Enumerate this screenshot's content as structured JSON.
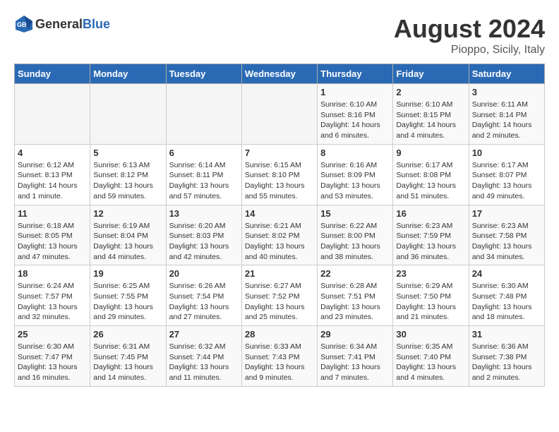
{
  "header": {
    "logo_general": "General",
    "logo_blue": "Blue",
    "month_year": "August 2024",
    "location": "Pioppo, Sicily, Italy"
  },
  "weekdays": [
    "Sunday",
    "Monday",
    "Tuesday",
    "Wednesday",
    "Thursday",
    "Friday",
    "Saturday"
  ],
  "weeks": [
    [
      {
        "day": "",
        "info": ""
      },
      {
        "day": "",
        "info": ""
      },
      {
        "day": "",
        "info": ""
      },
      {
        "day": "",
        "info": ""
      },
      {
        "day": "1",
        "info": "Sunrise: 6:10 AM\nSunset: 8:16 PM\nDaylight: 14 hours and 6 minutes."
      },
      {
        "day": "2",
        "info": "Sunrise: 6:10 AM\nSunset: 8:15 PM\nDaylight: 14 hours and 4 minutes."
      },
      {
        "day": "3",
        "info": "Sunrise: 6:11 AM\nSunset: 8:14 PM\nDaylight: 14 hours and 2 minutes."
      }
    ],
    [
      {
        "day": "4",
        "info": "Sunrise: 6:12 AM\nSunset: 8:13 PM\nDaylight: 14 hours and 1 minute."
      },
      {
        "day": "5",
        "info": "Sunrise: 6:13 AM\nSunset: 8:12 PM\nDaylight: 13 hours and 59 minutes."
      },
      {
        "day": "6",
        "info": "Sunrise: 6:14 AM\nSunset: 8:11 PM\nDaylight: 13 hours and 57 minutes."
      },
      {
        "day": "7",
        "info": "Sunrise: 6:15 AM\nSunset: 8:10 PM\nDaylight: 13 hours and 55 minutes."
      },
      {
        "day": "8",
        "info": "Sunrise: 6:16 AM\nSunset: 8:09 PM\nDaylight: 13 hours and 53 minutes."
      },
      {
        "day": "9",
        "info": "Sunrise: 6:17 AM\nSunset: 8:08 PM\nDaylight: 13 hours and 51 minutes."
      },
      {
        "day": "10",
        "info": "Sunrise: 6:17 AM\nSunset: 8:07 PM\nDaylight: 13 hours and 49 minutes."
      }
    ],
    [
      {
        "day": "11",
        "info": "Sunrise: 6:18 AM\nSunset: 8:05 PM\nDaylight: 13 hours and 47 minutes."
      },
      {
        "day": "12",
        "info": "Sunrise: 6:19 AM\nSunset: 8:04 PM\nDaylight: 13 hours and 44 minutes."
      },
      {
        "day": "13",
        "info": "Sunrise: 6:20 AM\nSunset: 8:03 PM\nDaylight: 13 hours and 42 minutes."
      },
      {
        "day": "14",
        "info": "Sunrise: 6:21 AM\nSunset: 8:02 PM\nDaylight: 13 hours and 40 minutes."
      },
      {
        "day": "15",
        "info": "Sunrise: 6:22 AM\nSunset: 8:00 PM\nDaylight: 13 hours and 38 minutes."
      },
      {
        "day": "16",
        "info": "Sunrise: 6:23 AM\nSunset: 7:59 PM\nDaylight: 13 hours and 36 minutes."
      },
      {
        "day": "17",
        "info": "Sunrise: 6:23 AM\nSunset: 7:58 PM\nDaylight: 13 hours and 34 minutes."
      }
    ],
    [
      {
        "day": "18",
        "info": "Sunrise: 6:24 AM\nSunset: 7:57 PM\nDaylight: 13 hours and 32 minutes."
      },
      {
        "day": "19",
        "info": "Sunrise: 6:25 AM\nSunset: 7:55 PM\nDaylight: 13 hours and 29 minutes."
      },
      {
        "day": "20",
        "info": "Sunrise: 6:26 AM\nSunset: 7:54 PM\nDaylight: 13 hours and 27 minutes."
      },
      {
        "day": "21",
        "info": "Sunrise: 6:27 AM\nSunset: 7:52 PM\nDaylight: 13 hours and 25 minutes."
      },
      {
        "day": "22",
        "info": "Sunrise: 6:28 AM\nSunset: 7:51 PM\nDaylight: 13 hours and 23 minutes."
      },
      {
        "day": "23",
        "info": "Sunrise: 6:29 AM\nSunset: 7:50 PM\nDaylight: 13 hours and 21 minutes."
      },
      {
        "day": "24",
        "info": "Sunrise: 6:30 AM\nSunset: 7:48 PM\nDaylight: 13 hours and 18 minutes."
      }
    ],
    [
      {
        "day": "25",
        "info": "Sunrise: 6:30 AM\nSunset: 7:47 PM\nDaylight: 13 hours and 16 minutes."
      },
      {
        "day": "26",
        "info": "Sunrise: 6:31 AM\nSunset: 7:45 PM\nDaylight: 13 hours and 14 minutes."
      },
      {
        "day": "27",
        "info": "Sunrise: 6:32 AM\nSunset: 7:44 PM\nDaylight: 13 hours and 11 minutes."
      },
      {
        "day": "28",
        "info": "Sunrise: 6:33 AM\nSunset: 7:43 PM\nDaylight: 13 hours and 9 minutes."
      },
      {
        "day": "29",
        "info": "Sunrise: 6:34 AM\nSunset: 7:41 PM\nDaylight: 13 hours and 7 minutes."
      },
      {
        "day": "30",
        "info": "Sunrise: 6:35 AM\nSunset: 7:40 PM\nDaylight: 13 hours and 4 minutes."
      },
      {
        "day": "31",
        "info": "Sunrise: 6:36 AM\nSunset: 7:38 PM\nDaylight: 13 hours and 2 minutes."
      }
    ]
  ]
}
